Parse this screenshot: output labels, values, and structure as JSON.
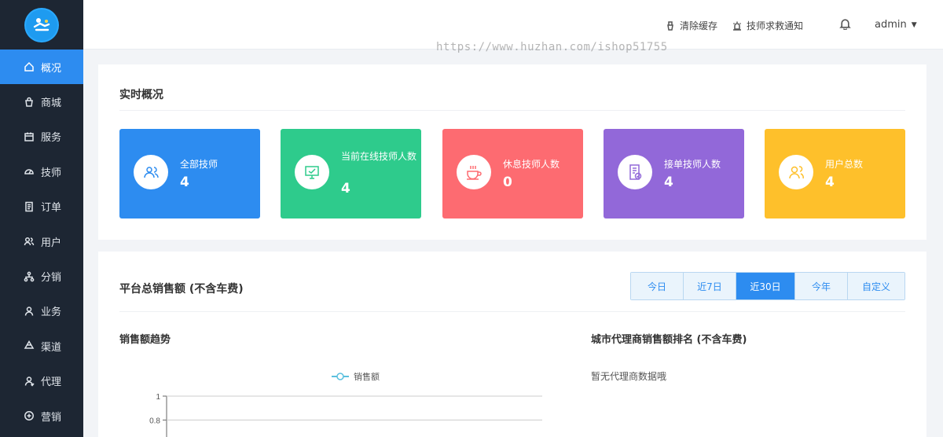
{
  "sidebar": {
    "items": [
      {
        "label": "概况",
        "icon": "home-icon",
        "active": true
      },
      {
        "label": "商城",
        "icon": "shop-bag-icon"
      },
      {
        "label": "服务",
        "icon": "calendar-icon"
      },
      {
        "label": "技师",
        "icon": "dashboard-icon"
      },
      {
        "label": "订单",
        "icon": "document-icon"
      },
      {
        "label": "用户",
        "icon": "users-icon"
      },
      {
        "label": "分销",
        "icon": "share-tree-icon"
      },
      {
        "label": "业务",
        "icon": "user-icon"
      },
      {
        "label": "渠道",
        "icon": "recycle-icon"
      },
      {
        "label": "代理",
        "icon": "agent-icon"
      },
      {
        "label": "营销",
        "icon": "gift-icon"
      }
    ]
  },
  "header": {
    "clear_cache": "清除缓存",
    "rescue_notice": "技师求救通知",
    "user": "admin",
    "watermark": "https://www.huzhan.com/ishop51755"
  },
  "overview": {
    "title": "实时概况",
    "stats": [
      {
        "label": "全部技师",
        "value": "4",
        "color": "#2d8cf0",
        "icon": "technicians-icon"
      },
      {
        "label": "当前在线技师人数",
        "value": "4",
        "color": "#2ecb8c",
        "icon": "monitor-icon"
      },
      {
        "label": "休息技师人数",
        "value": "0",
        "color": "#fd6b71",
        "icon": "coffee-icon"
      },
      {
        "label": "接单技师人数",
        "value": "4",
        "color": "#9268d9",
        "icon": "order-check-icon"
      },
      {
        "label": "用户总数",
        "value": "4",
        "color": "#fec02b",
        "icon": "user-total-icon"
      }
    ]
  },
  "sales": {
    "title": "平台总销售额 (不含车费)",
    "tabs": [
      "今日",
      "近7日",
      "近30日",
      "今年",
      "自定义"
    ],
    "active_tab": 2,
    "trend_title": "销售额趋势",
    "legend": "销售额",
    "ranking_title": "城市代理商销售额排名 (不含车费)",
    "ranking_empty": "暂无代理商数据哦"
  },
  "chart_data": {
    "type": "line",
    "series": [
      {
        "name": "销售额",
        "values": []
      }
    ],
    "y_ticks": [
      "1",
      "0.8"
    ],
    "ylim": [
      0,
      1
    ],
    "grid": true
  }
}
